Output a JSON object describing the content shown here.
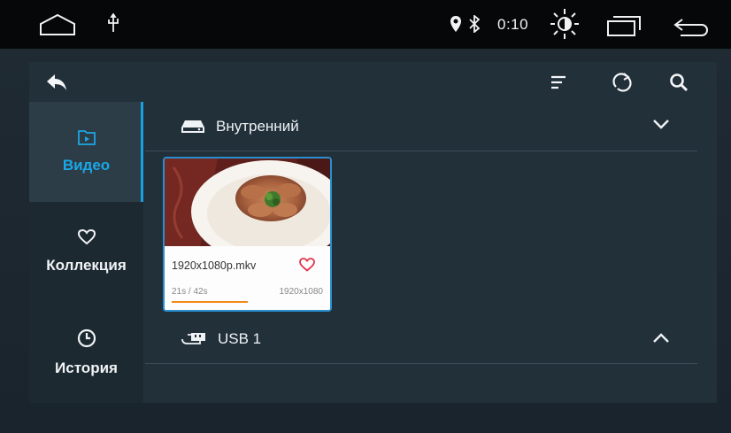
{
  "status_bar": {
    "time": "0:10",
    "icons": [
      "home-icon",
      "usb-icon",
      "location-icon",
      "bluetooth-icon",
      "brightness-icon",
      "recent-apps-icon",
      "back-icon"
    ]
  },
  "toolbar": {
    "back_icon": "back-arrow-icon",
    "sort_icon": "sort-icon",
    "refresh_icon": "refresh-icon",
    "search_icon": "search-icon"
  },
  "sidebar": {
    "items": [
      {
        "label": "Видео",
        "icon": "video-folder-icon",
        "active": true
      },
      {
        "label": "Коллекция",
        "icon": "heart-icon",
        "active": false
      },
      {
        "label": "История",
        "icon": "clock-icon",
        "active": false
      }
    ]
  },
  "sections": [
    {
      "title": "Внутренний",
      "icon": "drive-icon",
      "expanded": true
    },
    {
      "title": "USB 1",
      "icon": "usb-drive-icon",
      "expanded": false
    }
  ],
  "videos": [
    {
      "filename": "1920x1080p.mkv",
      "position": "21s / 42s",
      "resolution": "1920x1080",
      "progress": 0.5,
      "favorite": false
    }
  ],
  "colors": {
    "accent": "#1aa7e6",
    "progress": "#f08a1a",
    "favorite": "#e0334a"
  }
}
